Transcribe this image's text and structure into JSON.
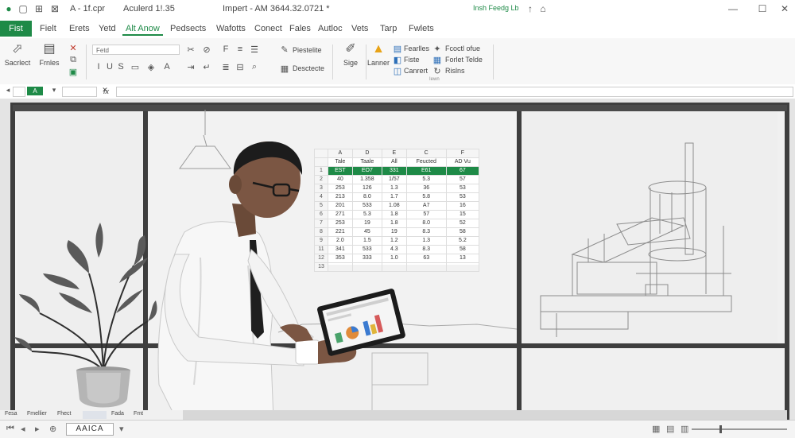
{
  "titlebar": {
    "left_items": [
      "A - 1f.cpr",
      "Aculerd 1!.35"
    ],
    "doc_title": "Impert - AM 3644.32.0721 *",
    "right_text": "Insh Feedg Lb"
  },
  "menu": {
    "file": "Fist",
    "tabs": [
      "Fielt",
      "Erets",
      "Yetd",
      "Alt Anow",
      "Pedsects",
      "Wafotts",
      "Conect",
      "Fales",
      "Autloc",
      "Vets",
      "Tarp",
      "Fwlets"
    ]
  },
  "ribbon": {
    "big_buttons": [
      "Sacrlect",
      "Frnles"
    ],
    "font_placeholder": "Fetd",
    "group1": [
      "Piestelite",
      "Desctecte"
    ],
    "big2": "Sige",
    "big3": "Lanner",
    "list1": [
      "Fearlles",
      "Fiste",
      "Canrert"
    ],
    "list2": [
      "Fcoctl ofue",
      "Forlet Telde",
      "Rislns"
    ],
    "group_label": "Iewn"
  },
  "formula": {
    "cell_ref": "A",
    "fx": "fx"
  },
  "sheet": {
    "col_headers": [
      "A",
      "D",
      "E",
      "C",
      "F"
    ],
    "field_row": [
      "Tale",
      "Taale",
      "All",
      "Feucted",
      "AD Vu"
    ],
    "rows": [
      {
        "n": "1",
        "cells": [
          "EST",
          "EO7",
          "331",
          "E61",
          "67"
        ],
        "hl": true
      },
      {
        "n": "2",
        "cells": [
          "40",
          "1.358",
          "1/57",
          "5.3",
          "57"
        ]
      },
      {
        "n": "3",
        "cells": [
          "253",
          "126",
          "1.3",
          "36",
          "53"
        ]
      },
      {
        "n": "4",
        "cells": [
          "213",
          "8.0",
          "1.7",
          "5.8",
          "53"
        ]
      },
      {
        "n": "5",
        "cells": [
          "201",
          "533",
          "1.08",
          "A7",
          "16"
        ]
      },
      {
        "n": "6",
        "cells": [
          "271",
          "5.3",
          "1.8",
          "57",
          "15"
        ]
      },
      {
        "n": "7",
        "cells": [
          "253",
          "19",
          "1.8",
          "8.0",
          "52"
        ]
      },
      {
        "n": "8",
        "cells": [
          "221",
          "45",
          "19",
          "8.3",
          "58"
        ]
      },
      {
        "n": "9",
        "cells": [
          "2.0",
          "1.5",
          "1.2",
          "1.3",
          "5.2"
        ]
      },
      {
        "n": "11",
        "cells": [
          "341",
          "533",
          "4.3",
          "8.3",
          "58"
        ]
      },
      {
        "n": "12",
        "cells": [
          "353",
          "333",
          "1.0",
          "63",
          "13"
        ]
      },
      {
        "n": "13",
        "cells": [
          "",
          "",
          "",
          "",
          ""
        ]
      }
    ]
  },
  "sheet_tabs": [
    "Fesa",
    "Fmellier",
    "Fhect",
    "",
    "Fada",
    "Fmt"
  ],
  "status": {
    "namebox": "AAICA"
  },
  "colors": {
    "accent": "#1e8a47",
    "canvas": "#e7e7e7",
    "frame": "#3e3e3e"
  }
}
